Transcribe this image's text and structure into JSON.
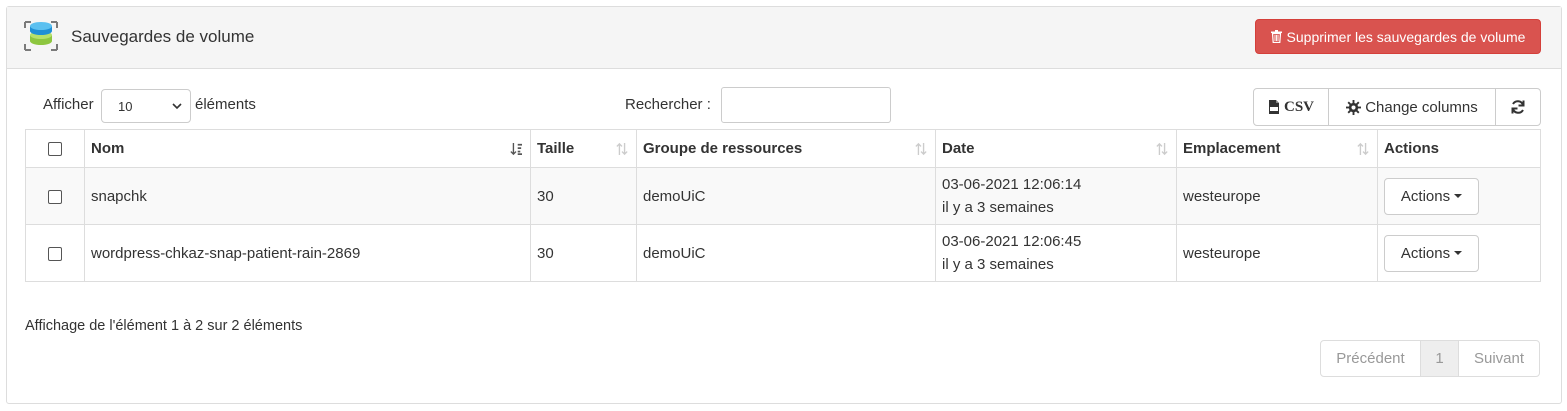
{
  "header": {
    "title": "Sauvegardes de volume",
    "delete_button": "Supprimer les sauvegardes de volume",
    "danger_color": "#d9534f"
  },
  "toolbar": {
    "length_label": "Afficher",
    "length_value": "10",
    "length_suffix": "éléments",
    "search_label": "Rechercher :",
    "search_value": "",
    "csv_label": "CSV",
    "columns_label": "Change columns"
  },
  "table": {
    "columns": [
      "Nom",
      "Taille",
      "Groupe de ressources",
      "Date",
      "Emplacement",
      "Actions"
    ],
    "rows": [
      {
        "nom": "snapchk",
        "taille": "30",
        "groupe": "demoUiC",
        "date": "03-06-2021 12:06:14",
        "date_relative": "il y a 3 semaines",
        "emplacement": "westeurope",
        "actions": "Actions"
      },
      {
        "nom": "wordpress-chkaz-snap-patient-rain-2869",
        "taille": "30",
        "groupe": "demoUiC",
        "date": "03-06-2021 12:06:45",
        "date_relative": "il y a 3 semaines",
        "emplacement": "westeurope",
        "actions": "Actions"
      }
    ]
  },
  "footer": {
    "info": "Affichage de l'élément 1 à 2 sur 2 éléments",
    "prev": "Précédent",
    "page": "1",
    "next": "Suivant"
  }
}
